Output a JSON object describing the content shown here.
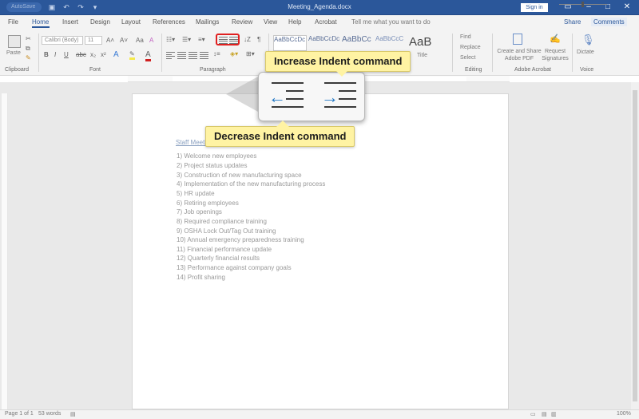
{
  "titlebar": {
    "autosave": "AutoSave",
    "qa_icons": [
      "save-icon",
      "undo-icon",
      "redo-icon",
      "customize-icon"
    ],
    "document_title": "Meeting_Agenda.docx",
    "sign_in": "Sign in",
    "window_controls": [
      "ribbon-display-icon",
      "minimize-icon",
      "maximize-icon",
      "close-icon"
    ]
  },
  "menu": {
    "tabs": [
      "File",
      "Home",
      "Insert",
      "Design",
      "Layout",
      "References",
      "Mailings",
      "Review",
      "View",
      "Help",
      "Acrobat"
    ],
    "active_tab": "Home",
    "tell_me": "Tell me what you want to do",
    "share": "Share",
    "comments": "Comments"
  },
  "ribbon": {
    "clipboard": {
      "paste": "Paste",
      "label": "Clipboard"
    },
    "font": {
      "name": "Calibri (Body)",
      "size": "11",
      "format_buttons": [
        "B",
        "I",
        "U",
        "abc",
        "x₂",
        "x²"
      ],
      "label": "Font"
    },
    "paragraph": {
      "label": "Paragraph"
    },
    "styles": {
      "swatches": [
        "AaBbCcDc",
        "AaBbCcDc",
        "AaBbCc",
        "AaBbCcC",
        "AaB"
      ],
      "title_label": "Title"
    },
    "editing": {
      "find": "Find",
      "replace": "Replace",
      "select": "Select",
      "label": "Editing"
    },
    "adobe": {
      "create_share": "Create and Share Adobe PDF",
      "request_signatures": "Request Signatures",
      "label": "Adobe Acrobat"
    },
    "voice": {
      "dictate": "Dictate",
      "label": "Voice"
    }
  },
  "document": {
    "heading": "Staff Meeting",
    "agenda": [
      "1)   Welcome new employees",
      "2)   Project status updates",
      "3)   Construction of new manufacturing space",
      "4)   Implementation of the new manufacturing process",
      "5)   HR update",
      "6)   Retiring employees",
      "7)   Job openings",
      "8)   Required compliance training",
      "9)   OSHA Lock Out/Tag Out training",
      "10)  Annual emergency preparedness training",
      "11)  Financial performance update",
      "12)  Quarterly financial results",
      "13)  Performance against company goals",
      "14)  Profit sharing"
    ]
  },
  "status": {
    "page": "Page 1 of 1",
    "words": "53 words",
    "zoom": "100%"
  },
  "callouts": {
    "increase_indent": "Increase Indent command",
    "decrease_indent": "Decrease Indent command"
  },
  "colors": {
    "title_bar": "#2b579a",
    "callout_fill": "#fff3a3",
    "indent_arrow": "#2479c6",
    "highlight_box": "#e02020"
  }
}
